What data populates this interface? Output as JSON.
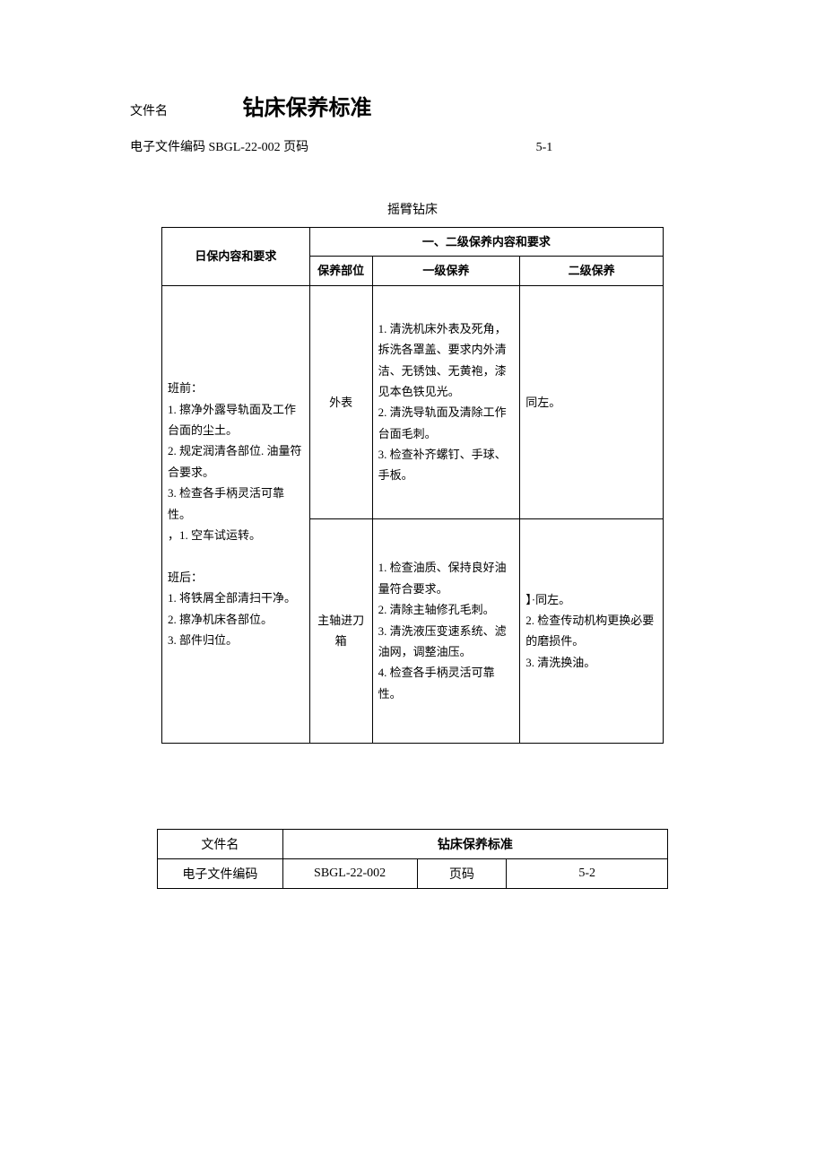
{
  "header": {
    "file_label": "文件名",
    "title": "钻床保养标准",
    "code_label": "电子文件编码",
    "code_value": "SBGL-22-002",
    "page_label": "页码",
    "page_value": "5-1"
  },
  "section_title": "摇臂钻床",
  "table": {
    "col_daily": "日保内容和要求",
    "col_group": "一、二级保养内容和要求",
    "col_part": "保养部位",
    "col_l1": "一级保养",
    "col_l2": "二级保养",
    "daily_content": "班前：\n1. 擦净外露导轨面及工作台面的尘土。\n2. 规定润清各部位. 油量符合要求。\n3. 检查各手柄灵活可靠性。\n，1. 空车试运转。\n\n班后：\n1. 将铁屑全部清扫干净。\n2. 擦净机床各部位。\n3. 部件归位。",
    "rows": [
      {
        "part": "外表",
        "l1": "1. 清洗机床外表及死角，拆洗各罩盖、要求内外清洁、无锈蚀、无黄袍，漆见本色铁见光。\n2. 清洗导轨面及清除工作台面毛刺。\n3. 检查补齐螺钉、手球、手板。",
        "l2": "同左。"
      },
      {
        "part": "主轴进刀箱",
        "l1": "1. 检查油质、保持良好油量符合要求。\n2. 清除主轴修孔毛刺。\n3. 清洗液压变速系统、滤油网，调整油压。\n4. 检查各手柄灵活可靠性。",
        "l2": "】·同左。\n2. 检查传动机构更换必要的磨损件。\n3. 清洗换油。"
      }
    ]
  },
  "footer": {
    "file_label": "文件名",
    "title": "钻床保养标准",
    "code_label": "电子文件编码",
    "code_value": "SBGL-22-002",
    "page_label": "页码",
    "page_value": "5-2"
  }
}
